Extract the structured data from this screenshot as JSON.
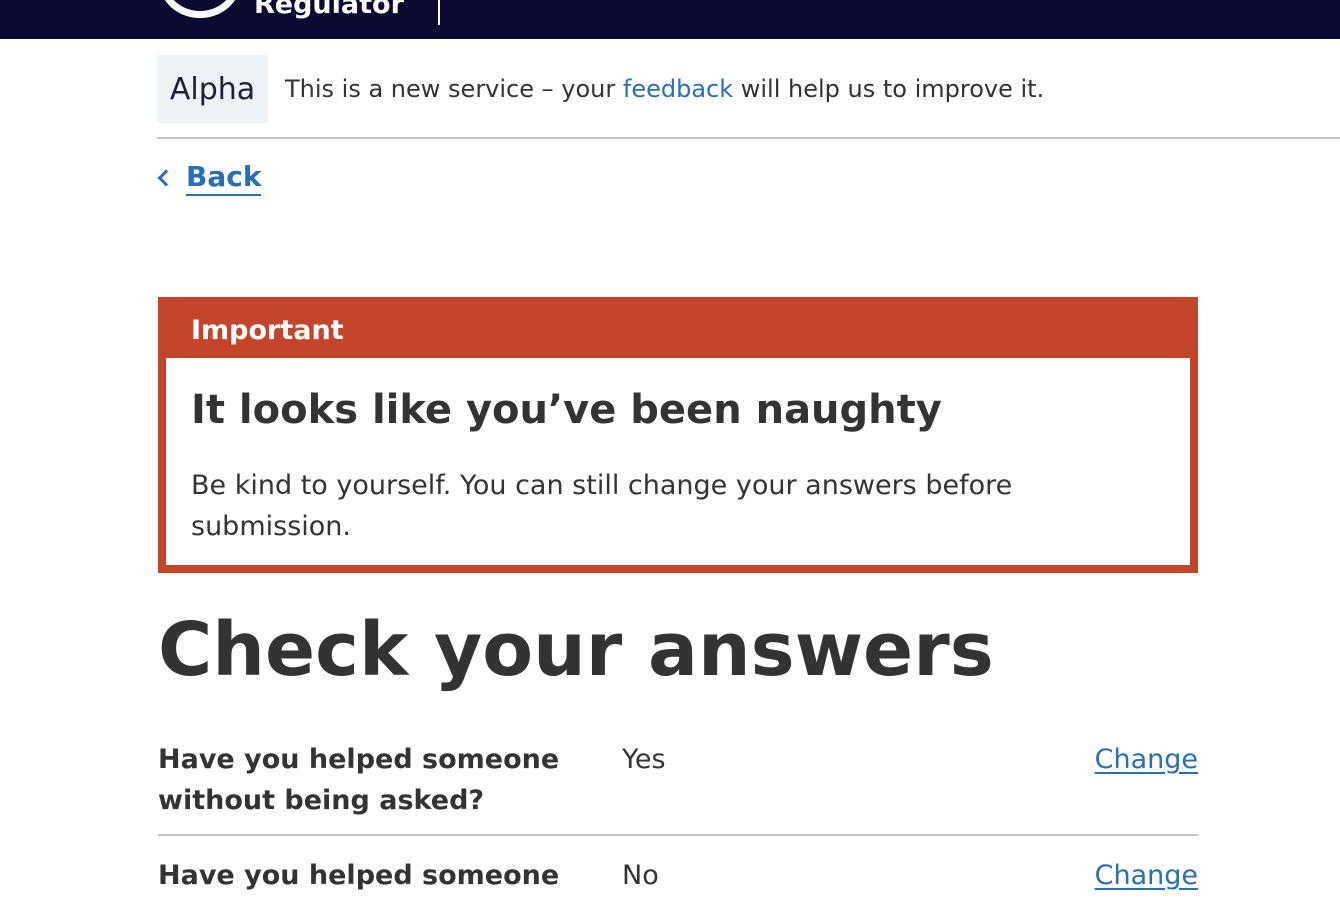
{
  "header": {
    "brand": "Regulator"
  },
  "phase_banner": {
    "tag": "Alpha",
    "text_before": "This is a new service – your ",
    "link": "feedback",
    "text_after": " will help us to improve it."
  },
  "back_link": "Back",
  "notification": {
    "title": "Important",
    "heading": "It looks like you’ve been naughty",
    "body": "Be kind to yourself. You can still change your answers before submission."
  },
  "page_title": "Check your answers",
  "summary": [
    {
      "question": "Have you helped someone without being asked?",
      "answer": "Yes",
      "action": "Change"
    },
    {
      "question": "Have you helped someone",
      "answer": "No",
      "action": "Change"
    }
  ],
  "colors": {
    "header_bg": "#0b0a30",
    "link": "#2a6fb3",
    "important": "#c4452c",
    "phase_tag_bg": "#eef3f8"
  }
}
